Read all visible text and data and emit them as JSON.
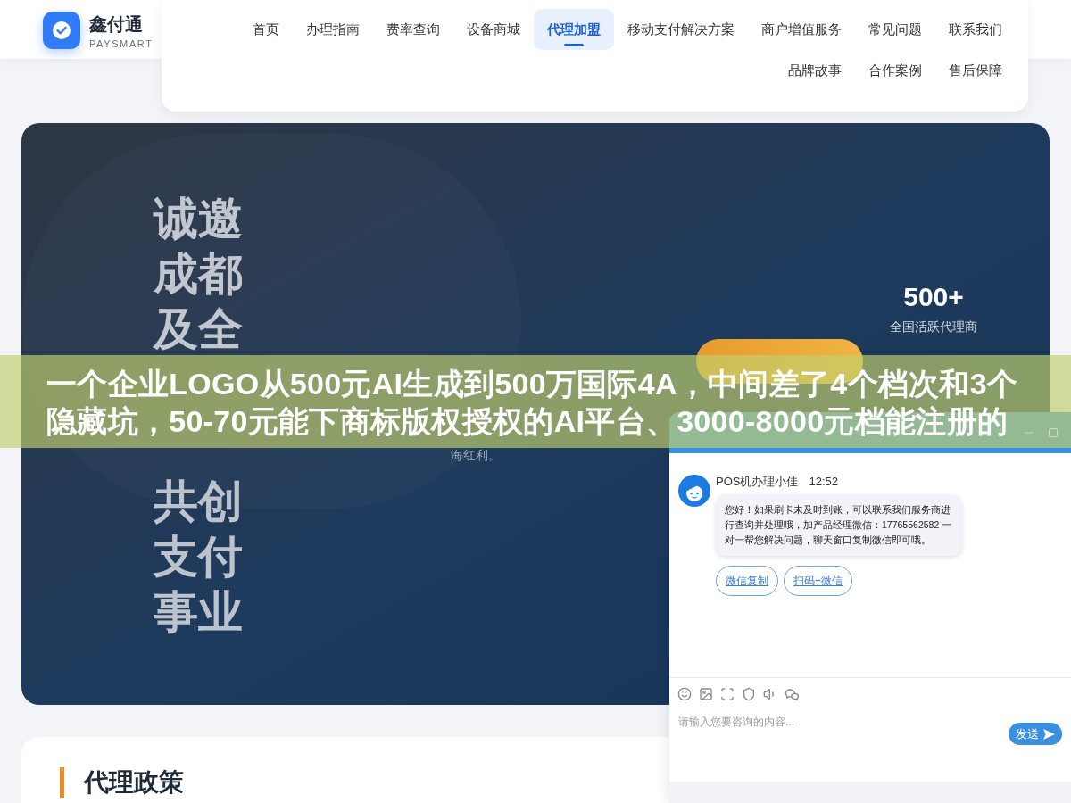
{
  "header": {
    "logo": {
      "name": "鑫付通",
      "tagline": "PAYSMART"
    },
    "nav": [
      {
        "label": "首页",
        "selected": false
      },
      {
        "label": "办理指南",
        "selected": false
      },
      {
        "label": "费率查询",
        "selected": false
      },
      {
        "label": "设备商城",
        "selected": false
      },
      {
        "label": "代理加盟",
        "selected": true
      },
      {
        "label": "移动支付解决方案",
        "selected": false
      },
      {
        "label": "商户增值服务",
        "selected": false
      },
      {
        "label": "常见问题",
        "selected": false
      },
      {
        "label": "联系我们",
        "selected": false
      },
      {
        "label": "品牌故事",
        "selected": false
      },
      {
        "label": "合作案例",
        "selected": false
      },
      {
        "label": "售后保障",
        "selected": false
      }
    ]
  },
  "hero": {
    "heading_top_lines": [
      "诚邀",
      "成都",
      "及全"
    ],
    "heading_bottom_lines": [
      "共创",
      "支付",
      "事业"
    ],
    "description": "海红利。",
    "stat": {
      "value": "500+",
      "label": "全国活跃代理商"
    }
  },
  "policy_section": {
    "title": "代理政策"
  },
  "chat_window": {
    "agent_name": "POS机办理小佳",
    "time": "12:52",
    "message": "您好！如果刷卡未及时到账，可以联系我们服务商进行查询并处理哦，加产品经理微信：17765562582 一对一帮您解决问题，聊天窗口复制微信即可哦。",
    "quick_replies": [
      "微信复制",
      "扫码+微信"
    ],
    "input": {
      "placeholder": "请输入您要咨询的内容..."
    },
    "send_button": "发送"
  },
  "caption_banner": {
    "lines": [
      "一个企业LOGO从500元AI生成到500万国际4A，中间差了4个档次和3个",
      "隐藏坑，50-70元能下商标版权授权的AI平台、3000-8000元档能注册的"
    ]
  }
}
